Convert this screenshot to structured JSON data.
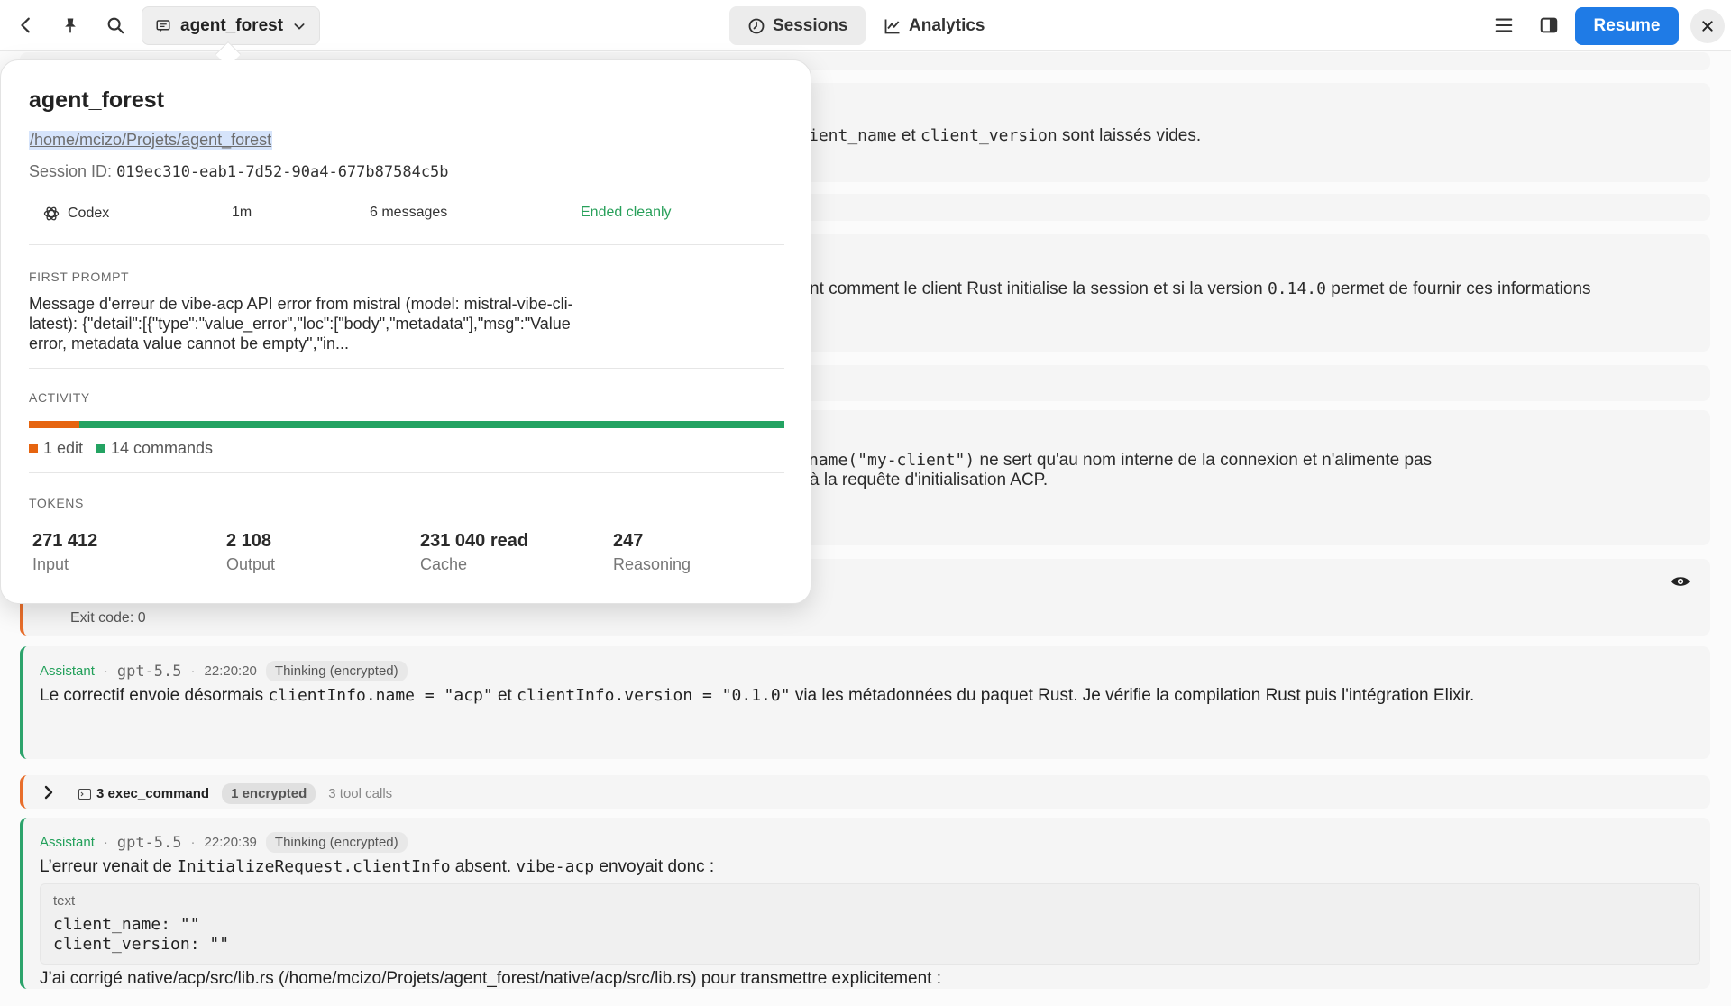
{
  "topbar": {
    "workspace": "agent_forest",
    "tabs": [
      {
        "label": "Sessions",
        "active": true
      },
      {
        "label": "Analytics",
        "active": false
      }
    ],
    "resume_label": "Resume"
  },
  "colors": {
    "accent_blue": "#1f7be6",
    "assistant_green": "#22a05a",
    "edit_orange": "#e6640f",
    "commands_green": "#23a362"
  },
  "popover": {
    "title": "agent_forest",
    "path": "/home/mcizo/Projets/agent_forest",
    "session_label": "Session ID:",
    "session_id": "019ec310-eab1-7d52-90a4-677b87584c5b",
    "agent": "Codex",
    "duration": "1m",
    "messages": "6 messages",
    "status": "Ended cleanly",
    "first_prompt_label": "FIRST PROMPT",
    "first_prompt_line1": "Message d'erreur de vibe-acp API error from mistral (model: mistral-vibe-cli-",
    "first_prompt_line2": "latest): {\"detail\":[{\"type\":\"value_error\",\"loc\":[\"body\",\"metadata\"],\"msg\":\"Value",
    "first_prompt_line3": "error, metadata value cannot be empty\",\"in...",
    "activity_label": "ACTIVITY",
    "edit_fraction": 0.0667,
    "edits_label": "1 edit",
    "commands_label": "14 commands",
    "tokens_label": "TOKENS",
    "tokens": [
      {
        "value": "271 412",
        "label": "Input"
      },
      {
        "value": "2 108",
        "label": "Output"
      },
      {
        "value": "231 040 read",
        "label": "Cache"
      },
      {
        "value": "247",
        "label": "Reasoning"
      }
    ]
  },
  "stream": {
    "line1_pre": "ient_name",
    "line1_mid": " et ",
    "line1_code": "client_version",
    "line1_post": " sont laissés vides.",
    "line2_pre": "nt comment le client Rust initialise la session et si la version ",
    "line2_code": "0.14.0",
    "line2_post": " permet de fournir ces informations",
    "line3_code": "name(\"my-client\")",
    "line3_post": " ne sert qu'au nom interne de la connexion et n'alimente pas",
    "line4": "à la requête d'initialisation ACP.",
    "exit_code": "Exit code: 0",
    "msg1": {
      "role": "Assistant",
      "model": "gpt-5.5",
      "time": "22:20:20",
      "badge": "Thinking (encrypted)",
      "t1": "Le correctif envoie désormais ",
      "c1": "clientInfo.name = \"acp\"",
      "t2": " et ",
      "c2": "clientInfo.version = \"0.1.0\"",
      "t3": " via les métadonnées du paquet Rust. Je vérifie la compilation Rust puis l'intégration Elixir."
    },
    "tool_group": {
      "label": "3 exec_command",
      "badge": "1 encrypted",
      "count": "3 tool calls"
    },
    "msg2": {
      "role": "Assistant",
      "model": "gpt-5.5",
      "time": "22:20:39",
      "badge": "Thinking (encrypted)",
      "t1": "L’erreur venait de ",
      "c1": "InitializeRequest.clientInfo",
      "t2": " absent. ",
      "c2": "vibe-acp",
      "t3": " envoyait donc :",
      "code_lang": "text",
      "code_line1": "client_name: \"\"",
      "code_line2": "client_version: \"\"",
      "footer": "J’ai corrigé native/acp/src/lib.rs (/home/mcizo/Projets/agent_forest/native/acp/src/lib.rs) pour transmettre explicitement :"
    }
  }
}
